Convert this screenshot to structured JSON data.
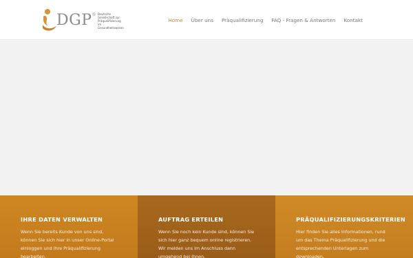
{
  "logo": {
    "name": "DGP",
    "reg": "®",
    "subtitle": "Deutsche Gesellschaft zur Präqualifizierung im Gesundheitswesen"
  },
  "nav": {
    "items": [
      {
        "label": "Home",
        "active": true
      },
      {
        "label": "Über uns",
        "active": false
      },
      {
        "label": "Präqualifizierung",
        "active": false
      },
      {
        "label": "FAQ - Fragen & Antworten",
        "active": false
      },
      {
        "label": "Kontakt",
        "active": false
      }
    ]
  },
  "colors": {
    "accent": "#c28a2f",
    "box_1": "#c8821f",
    "box_2": "#a0631b",
    "box_3": "#c98524"
  },
  "features": [
    {
      "title": "IHRE DATEN VERWALTEN",
      "text": "Wenn Sie bereits Kunde von uns sind, können Sie sich hier in unser Online-Portal einloggen und Ihre Präqualifizierung bearbeiten."
    },
    {
      "title": "AUFTRAG ERTEILEN",
      "text": "Wenn Sie noch kein Kunde sind, können Sie sich hier ganz bequem online registrieren. Wir melden uns im Anschluss dann umgehend bei Ihnen."
    },
    {
      "title": "PRÄQUALIFIZIERUNGSKRITERIEN",
      "text": "Hier finden Sie alles Informationen, rund um das Thema Präqualifizierung und die entsprechenden Unterlagen zum downloaden."
    }
  ]
}
